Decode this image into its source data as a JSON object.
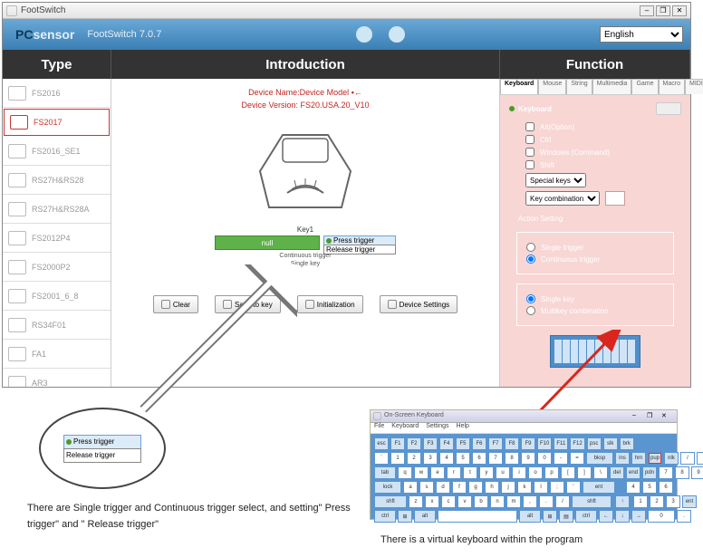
{
  "window": {
    "title": "FootSwitch",
    "ctrl_min": "–",
    "ctrl_max": "❐",
    "ctrl_close": "✕"
  },
  "bluebar": {
    "brand_a": "PC",
    "brand_b": "sensor",
    "app": "FootSwitch 7.0.7",
    "lang": "English"
  },
  "headers": {
    "type": "Type",
    "intro": "Introduction",
    "func": "Function"
  },
  "sidebar": {
    "items": [
      {
        "label": "FS2016"
      },
      {
        "label": "FS2017"
      },
      {
        "label": "FS2016_SE1"
      },
      {
        "label": "RS27H&RS28"
      },
      {
        "label": "RS27H&RS28A"
      },
      {
        "label": "FS2012P4"
      },
      {
        "label": "FS2000P2"
      },
      {
        "label": "FS2001_6_8"
      },
      {
        "label": "RS34F01"
      },
      {
        "label": "FA1"
      },
      {
        "label": "AR3"
      },
      {
        "label": "..."
      }
    ],
    "selected_index": 1
  },
  "center": {
    "line1": "Device Name:Device Model",
    "usb": "←",
    "line2": "Device Version:  FS20.USA.20_V10",
    "key_title": "Key1",
    "green_label": "null",
    "trigger_options": [
      "Press trigger",
      "Release trigger"
    ],
    "sub1": "Continuous trigger",
    "sub2": "Single key",
    "buttons": [
      "Clear",
      "Save to key",
      "Initialization",
      "Device Settings"
    ]
  },
  "tabs": [
    "Keyboard",
    "Mouse",
    "String",
    "Multimedia",
    "Game",
    "Macro",
    "MIDI"
  ],
  "func": {
    "keyboard_label": "Keyboard",
    "checks": [
      "Alt(Option)",
      "Ctrl",
      "Windows (Command)",
      "Shift"
    ],
    "special_sel": "Special keys",
    "combo_sel": "Key combination",
    "minibtn": "—",
    "action_title": "Action Setting",
    "radios_a": [
      "Single trigger",
      "Continuous trigger"
    ],
    "radios_b": [
      "Single key",
      "Multikey combination"
    ]
  },
  "kb_window": {
    "title": "On-Screen Keyboard",
    "menu": [
      "File",
      "Keyboard",
      "Settings",
      "Help"
    ],
    "btns": [
      "–",
      "❐",
      "✕"
    ]
  },
  "annotations": {
    "a1": "There are Single trigger and Continuous trigger select, and setting\" Press trigger\" and \" Release trigger\"",
    "a2": "There is a virtual keyboard within the program"
  }
}
